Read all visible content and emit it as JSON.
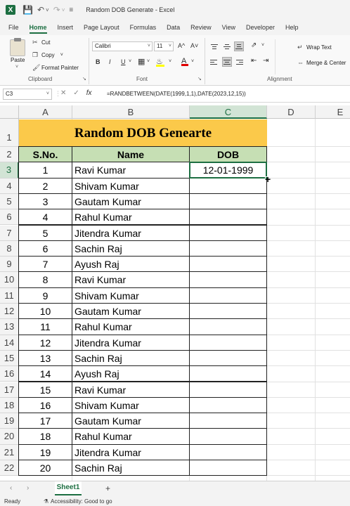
{
  "titlebar": {
    "title": "Random DOB Generate - Excel",
    "app_icon": "X"
  },
  "menu": [
    {
      "label": "File",
      "active": false
    },
    {
      "label": "Home",
      "active": true
    },
    {
      "label": "Insert",
      "active": false
    },
    {
      "label": "Page Layout",
      "active": false
    },
    {
      "label": "Formulas",
      "active": false
    },
    {
      "label": "Data",
      "active": false
    },
    {
      "label": "Review",
      "active": false
    },
    {
      "label": "View",
      "active": false
    },
    {
      "label": "Developer",
      "active": false
    },
    {
      "label": "Help",
      "active": false
    }
  ],
  "ribbon": {
    "clipboard": {
      "paste": "Paste",
      "cut": "Cut",
      "copy": "Copy",
      "format_painter": "Format Painter",
      "label": "Clipboard"
    },
    "font": {
      "name": "Calibri",
      "size": "11",
      "grow": "A^",
      "shrink": "A˅",
      "bold": "B",
      "italic": "I",
      "underline": "U",
      "label": "Font"
    },
    "alignment": {
      "wrap_text": "Wrap Text",
      "merge_center": "Merge & Center",
      "label": "Alignment"
    }
  },
  "formula_bar": {
    "name_box": "C3",
    "fx": "fx",
    "formula": "=RANDBETWEEN(DATE(1999,1,1),DATE(2023,12,15))"
  },
  "columns": [
    "A",
    "B",
    "C",
    "D",
    "E"
  ],
  "selected_column": "C",
  "rows": [
    "1",
    "2",
    "3",
    "4",
    "5",
    "6",
    "7",
    "8",
    "9",
    "10",
    "11",
    "12",
    "13",
    "14",
    "15",
    "16",
    "17",
    "18",
    "19",
    "20",
    "21",
    "22"
  ],
  "selected_row": "3",
  "sheet": {
    "title": "Random DOB Genearte",
    "headers": [
      "S.No.",
      "Name",
      "DOB"
    ],
    "data": [
      {
        "sno": "1",
        "name": "Ravi Kumar",
        "dob": "12-01-1999"
      },
      {
        "sno": "2",
        "name": "Shivam Kumar",
        "dob": ""
      },
      {
        "sno": "3",
        "name": "Gautam Kumar",
        "dob": ""
      },
      {
        "sno": "4",
        "name": "Rahul Kumar",
        "dob": ""
      },
      {
        "sno": "5",
        "name": "Jitendra Kumar",
        "dob": ""
      },
      {
        "sno": "6",
        "name": "Sachin Raj",
        "dob": ""
      },
      {
        "sno": "7",
        "name": "Ayush Raj",
        "dob": ""
      },
      {
        "sno": "8",
        "name": "Ravi Kumar",
        "dob": ""
      },
      {
        "sno": "9",
        "name": "Shivam Kumar",
        "dob": ""
      },
      {
        "sno": "10",
        "name": "Gautam Kumar",
        "dob": ""
      },
      {
        "sno": "11",
        "name": "Rahul Kumar",
        "dob": ""
      },
      {
        "sno": "12",
        "name": "Jitendra Kumar",
        "dob": ""
      },
      {
        "sno": "13",
        "name": "Sachin Raj",
        "dob": ""
      },
      {
        "sno": "14",
        "name": "Ayush Raj",
        "dob": ""
      },
      {
        "sno": "15",
        "name": "Ravi Kumar",
        "dob": ""
      },
      {
        "sno": "16",
        "name": "Shivam Kumar",
        "dob": ""
      },
      {
        "sno": "17",
        "name": "Gautam Kumar",
        "dob": ""
      },
      {
        "sno": "18",
        "name": "Rahul Kumar",
        "dob": ""
      },
      {
        "sno": "19",
        "name": "Jitendra Kumar",
        "dob": ""
      },
      {
        "sno": "20",
        "name": "Sachin Raj",
        "dob": ""
      }
    ]
  },
  "tabs": {
    "sheet_name": "Sheet1",
    "add": "+"
  },
  "status": {
    "ready": "Ready",
    "accessibility": "Accessibility: Good to go"
  },
  "colors": {
    "accent": "#1d6f42",
    "title_fill": "#fbc94a",
    "header_fill": "#c6dfb4"
  }
}
